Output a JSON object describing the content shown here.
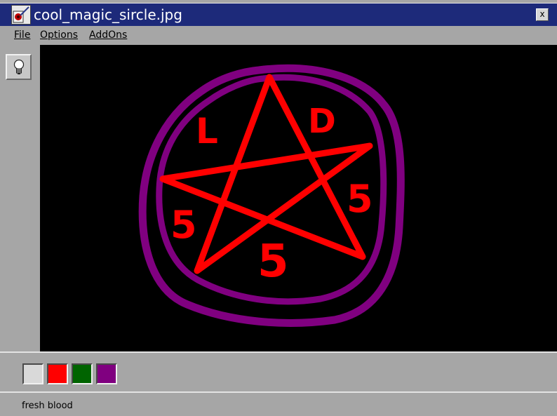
{
  "window": {
    "title": "cool_magic_sircle.jpg",
    "close_label": "x"
  },
  "menu": {
    "file": "File",
    "options": "Options",
    "addons": "AddOns"
  },
  "toolbar": {
    "tools": [
      {
        "icon": "lightbulb-icon"
      }
    ]
  },
  "canvas": {
    "background": "#000000",
    "letters": [
      "L",
      "D",
      "5",
      "5",
      "5"
    ],
    "colors": {
      "circle": "#800080",
      "star": "#ff0000"
    }
  },
  "palette": {
    "swatches": [
      "#d9d9d9",
      "#ff0000",
      "#006400",
      "#800080"
    ]
  },
  "status": {
    "text": "fresh blood"
  }
}
